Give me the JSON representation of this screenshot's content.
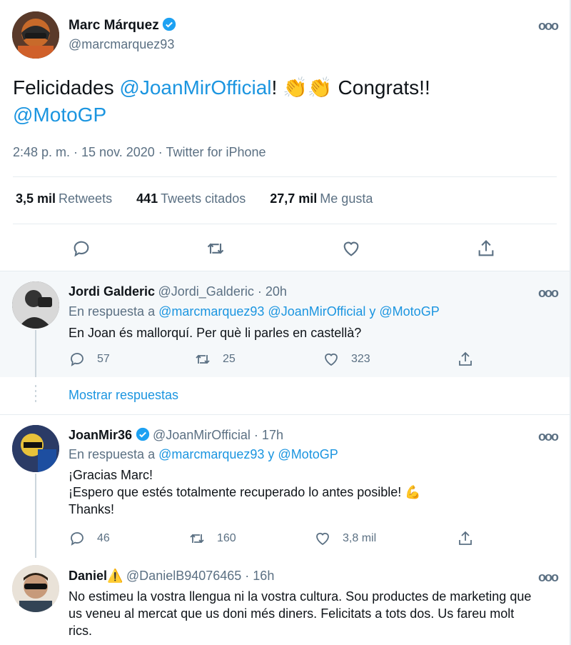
{
  "main_tweet": {
    "author_name": "Marc Márquez",
    "author_handle": "@marcmarquez93",
    "text_part1": "Felicidades ",
    "mention1": "@JoanMirOfficial",
    "text_part2": "! ",
    "clap_emoji": "👏👏",
    "text_part3": " Congrats!!",
    "mention2": "@MotoGP",
    "meta": "2:48 p. m. · 15 nov. 2020 · Twitter for iPhone",
    "stats": {
      "retweets_count": "3,5 mil",
      "retweets_label": "Retweets",
      "quotes_count": "441",
      "quotes_label": "Tweets citados",
      "likes_count": "27,7 mil",
      "likes_label": "Me gusta"
    },
    "more_icon": "ooo"
  },
  "replies": [
    {
      "name": "Jordi Galderic",
      "handle": "@Jordi_Galderic · 20h",
      "reply_prefix": "En respuesta a ",
      "reply_to": "@marcmarquez93 @JoanMirOfficial y @MotoGP",
      "text": "En Joan és mallorquí. Per què li parles en castellà?",
      "replies": "57",
      "retweets": "25",
      "likes": "323"
    },
    {
      "name": "JoanMir36",
      "handle": "@JoanMirOfficial · 17h",
      "reply_prefix": "En respuesta a ",
      "reply_to": "@marcmarquez93 y @MotoGP",
      "text_line1": "¡Gracias Marc!",
      "text_line2": "¡Espero que estés totalmente recuperado lo antes posible!",
      "text_emoji": "💪",
      "text_line3": "Thanks!",
      "replies": "46",
      "retweets": "160",
      "likes": "3,8 mil"
    },
    {
      "name": "Daniel",
      "name_emoji": "⚠️",
      "handle": "@DanielB94076465 · 16h",
      "text": "No estimeu la vostra llengua ni la vostra cultura. Sou productes de marketing que us veneu al mercat que us doni més diners. Felicitats a tots dos. Us fareu molt rics."
    }
  ],
  "show_replies": "Mostrar respuestas",
  "colors": {
    "accent": "#1b95e0",
    "secondary_text": "#5b7083",
    "border": "#e6ecf0",
    "reply_bg": "#f5f8fa"
  }
}
